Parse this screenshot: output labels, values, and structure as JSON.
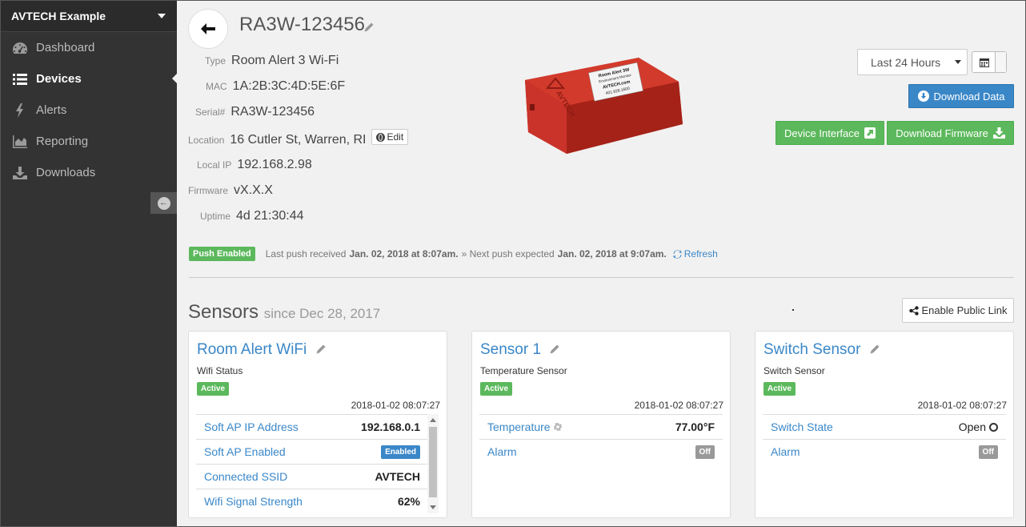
{
  "sidebar": {
    "org_name": "AVTECH Example",
    "items": [
      {
        "label": "Dashboard",
        "icon": "dashboard-icon"
      },
      {
        "label": "Devices",
        "icon": "list-icon",
        "active": true
      },
      {
        "label": "Alerts",
        "icon": "bolt-icon"
      },
      {
        "label": "Reporting",
        "icon": "area-chart-icon"
      },
      {
        "label": "Downloads",
        "icon": "download-icon"
      }
    ]
  },
  "device": {
    "name": "RA3W-123456",
    "fields": [
      {
        "label": "Type",
        "value": "Room Alert 3 Wi-Fi"
      },
      {
        "label": "MAC",
        "value": "1A:2B:3C:4D:5E:6F"
      },
      {
        "label": "Serial#",
        "value": "RA3W-123456"
      },
      {
        "label": "Location",
        "value": "16 Cutler St, Warren, RI"
      },
      {
        "label": "Local IP",
        "value": "192.168.2.98"
      },
      {
        "label": "Firmware",
        "value": "vX.X.X"
      },
      {
        "label": "Uptime",
        "value": "4d 21:30:44"
      }
    ],
    "edit_label": "Edit",
    "image_label": {
      "line1": "Room Alert 3W",
      "line2": "Environment Monitor",
      "line3": "AVTECH.com",
      "line4": "401.628.1600",
      "logo": "AVTECH"
    }
  },
  "controls": {
    "range_selected": "Last 24 Hours",
    "download_data": "Download Data",
    "device_interface": "Device Interface",
    "download_firmware": "Download Firmware"
  },
  "push": {
    "badge": "Push Enabled",
    "last_prefix": "Last push received",
    "last_time": "Jan. 02, 2018 at 8:07am.",
    "next_prefix": "» Next push expected",
    "next_time": "Jan. 02, 2018 at 9:07am.",
    "refresh": "Refresh"
  },
  "sensors": {
    "title": "Sensors",
    "since": "since Dec 28, 2017",
    "public_link": "Enable Public Link",
    "cards": [
      {
        "title": "Room Alert WiFi",
        "subtitle": "Wifi Status",
        "status": "Active",
        "timestamp": "2018-01-02 08:07:27",
        "rows": [
          {
            "label": "Soft AP IP Address",
            "value": "192.168.0.1"
          },
          {
            "label": "Soft AP Enabled",
            "value": "Enabled"
          },
          {
            "label": "Connected SSID",
            "value": "AVTECH"
          },
          {
            "label": "Wifi Signal Strength",
            "value": "62%"
          }
        ]
      },
      {
        "title": "Sensor 1",
        "subtitle": "Temperature Sensor",
        "status": "Active",
        "timestamp": "2018-01-02 08:07:27",
        "rows": [
          {
            "label": "Temperature",
            "value": "77.00°F"
          },
          {
            "label": "Alarm",
            "value": "Off"
          }
        ]
      },
      {
        "title": "Switch Sensor",
        "subtitle": "Switch Sensor",
        "status": "Active",
        "timestamp": "2018-01-02 08:07:27",
        "rows": [
          {
            "label": "Switch State",
            "value": "Open"
          },
          {
            "label": "Alarm",
            "value": "Off"
          }
        ]
      }
    ]
  }
}
